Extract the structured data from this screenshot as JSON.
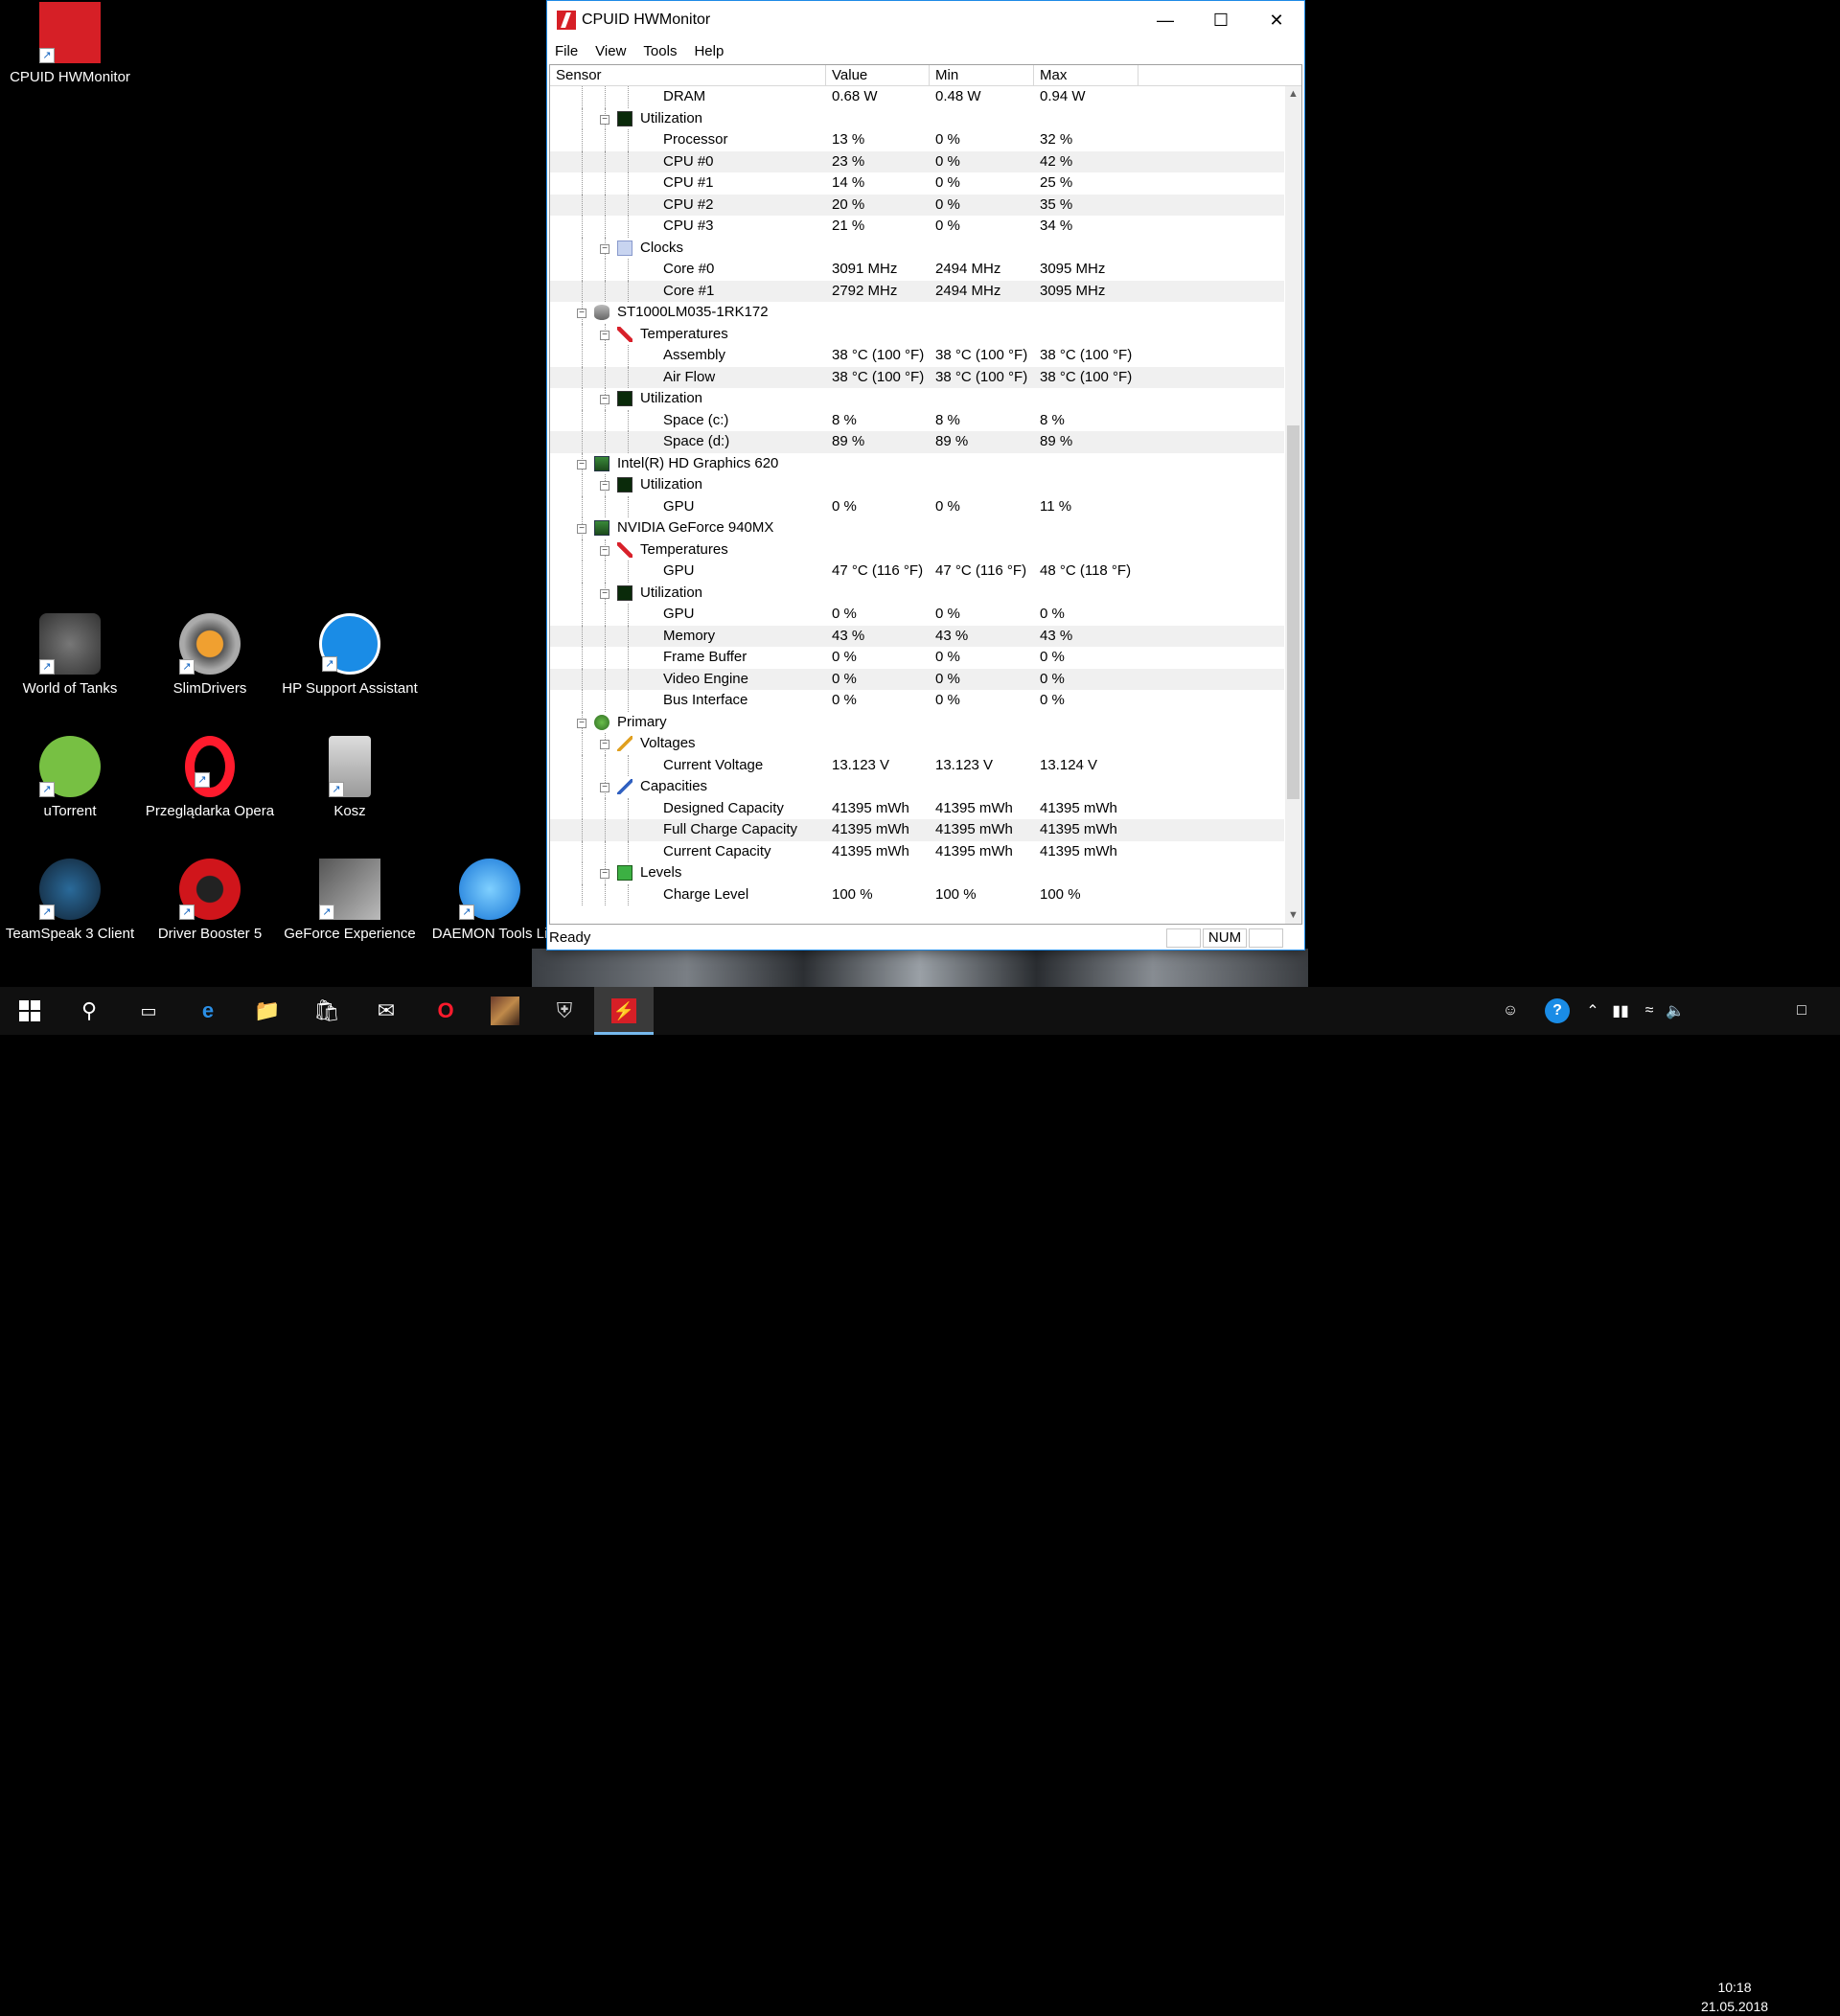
{
  "desktop_icons": [
    {
      "label": "CPUID HWMonitor",
      "icon": "hwmonitor-icon"
    },
    {
      "label": "World of Tanks",
      "icon": "world-of-tanks-icon"
    },
    {
      "label": "SlimDrivers",
      "icon": "slimdrivers-icon"
    },
    {
      "label": "HP Support Assistant",
      "icon": "hp-support-icon"
    },
    {
      "label": "uTorrent",
      "icon": "utorrent-icon"
    },
    {
      "label": "Przeglądarka Opera",
      "icon": "opera-icon"
    },
    {
      "label": "Kosz",
      "icon": "recycle-bin-icon"
    },
    {
      "label": "TeamSpeak 3 Client",
      "icon": "teamspeak-icon"
    },
    {
      "label": "Driver Booster 5",
      "icon": "driver-booster-icon"
    },
    {
      "label": "GeForce Experience",
      "icon": "geforce-experience-icon"
    },
    {
      "label": "DAEMON Tools Li",
      "icon": "daemon-tools-icon"
    }
  ],
  "window": {
    "title": "CPUID HWMonitor",
    "menu": [
      "File",
      "View",
      "Tools",
      "Help"
    ],
    "columns": [
      "Sensor",
      "Value",
      "Min",
      "Max"
    ],
    "rows": [
      {
        "level": 3,
        "name": "DRAM",
        "value": "0.68 W",
        "min": "0.48 W",
        "max": "0.94 W"
      },
      {
        "level": 2,
        "name": "Utilization",
        "icon": "util"
      },
      {
        "level": 3,
        "name": "Processor",
        "value": "13 %",
        "min": "0 %",
        "max": "32 %"
      },
      {
        "level": 3,
        "name": "CPU #0",
        "value": "23 %",
        "min": "0 %",
        "max": "42 %"
      },
      {
        "level": 3,
        "name": "CPU #1",
        "value": "14 %",
        "min": "0 %",
        "max": "25 %"
      },
      {
        "level": 3,
        "name": "CPU #2",
        "value": "20 %",
        "min": "0 %",
        "max": "35 %"
      },
      {
        "level": 3,
        "name": "CPU #3",
        "value": "21 %",
        "min": "0 %",
        "max": "34 %"
      },
      {
        "level": 2,
        "name": "Clocks",
        "icon": "clock"
      },
      {
        "level": 3,
        "name": "Core #0",
        "value": "3091 MHz",
        "min": "2494 MHz",
        "max": "3095 MHz"
      },
      {
        "level": 3,
        "name": "Core #1",
        "value": "2792 MHz",
        "min": "2494 MHz",
        "max": "3095 MHz"
      },
      {
        "level": 1,
        "name": "ST1000LM035-1RK172",
        "icon": "disk"
      },
      {
        "level": 2,
        "name": "Temperatures",
        "icon": "temp"
      },
      {
        "level": 3,
        "name": "Assembly",
        "value": "38 °C  (100 °F)",
        "min": "38 °C  (100 °F)",
        "max": "38 °C  (100 °F)"
      },
      {
        "level": 3,
        "name": "Air Flow",
        "value": "38 °C  (100 °F)",
        "min": "38 °C  (100 °F)",
        "max": "38 °C  (100 °F)"
      },
      {
        "level": 2,
        "name": "Utilization",
        "icon": "util"
      },
      {
        "level": 3,
        "name": "Space (c:)",
        "value": "8 %",
        "min": "8 %",
        "max": "8 %"
      },
      {
        "level": 3,
        "name": "Space (d:)",
        "value": "89 %",
        "min": "89 %",
        "max": "89 %"
      },
      {
        "level": 1,
        "name": "Intel(R) HD Graphics 620",
        "icon": "gpu"
      },
      {
        "level": 2,
        "name": "Utilization",
        "icon": "util"
      },
      {
        "level": 3,
        "name": "GPU",
        "value": "0 %",
        "min": "0 %",
        "max": "11 %"
      },
      {
        "level": 1,
        "name": "NVIDIA GeForce 940MX",
        "icon": "gpu"
      },
      {
        "level": 2,
        "name": "Temperatures",
        "icon": "temp"
      },
      {
        "level": 3,
        "name": "GPU",
        "value": "47 °C  (116 °F)",
        "min": "47 °C  (116 °F)",
        "max": "48 °C  (118 °F)"
      },
      {
        "level": 2,
        "name": "Utilization",
        "icon": "util"
      },
      {
        "level": 3,
        "name": "GPU",
        "value": "0 %",
        "min": "0 %",
        "max": "0 %"
      },
      {
        "level": 3,
        "name": "Memory",
        "value": "43 %",
        "min": "43 %",
        "max": "43 %"
      },
      {
        "level": 3,
        "name": "Frame Buffer",
        "value": "0 %",
        "min": "0 %",
        "max": "0 %"
      },
      {
        "level": 3,
        "name": "Video Engine",
        "value": "0 %",
        "min": "0 %",
        "max": "0 %"
      },
      {
        "level": 3,
        "name": "Bus Interface",
        "value": "0 %",
        "min": "0 %",
        "max": "0 %"
      },
      {
        "level": 1,
        "name": "Primary",
        "icon": "battery"
      },
      {
        "level": 2,
        "name": "Voltages",
        "icon": "volt"
      },
      {
        "level": 3,
        "name": "Current Voltage",
        "value": "13.123 V",
        "min": "13.123 V",
        "max": "13.124 V"
      },
      {
        "level": 2,
        "name": "Capacities",
        "icon": "cap"
      },
      {
        "level": 3,
        "name": "Designed Capacity",
        "value": "41395 mWh",
        "min": "41395 mWh",
        "max": "41395 mWh"
      },
      {
        "level": 3,
        "name": "Full Charge Capacity",
        "value": "41395 mWh",
        "min": "41395 mWh",
        "max": "41395 mWh"
      },
      {
        "level": 3,
        "name": "Current Capacity",
        "value": "41395 mWh",
        "min": "41395 mWh",
        "max": "41395 mWh"
      },
      {
        "level": 2,
        "name": "Levels",
        "icon": "level"
      },
      {
        "level": 3,
        "name": "Charge Level",
        "value": "100 %",
        "min": "100 %",
        "max": "100 %"
      }
    ],
    "status": "Ready",
    "status_num": "NUM"
  },
  "taskbar": {
    "clock_time": "10:18",
    "clock_date": "21.05.2018"
  }
}
